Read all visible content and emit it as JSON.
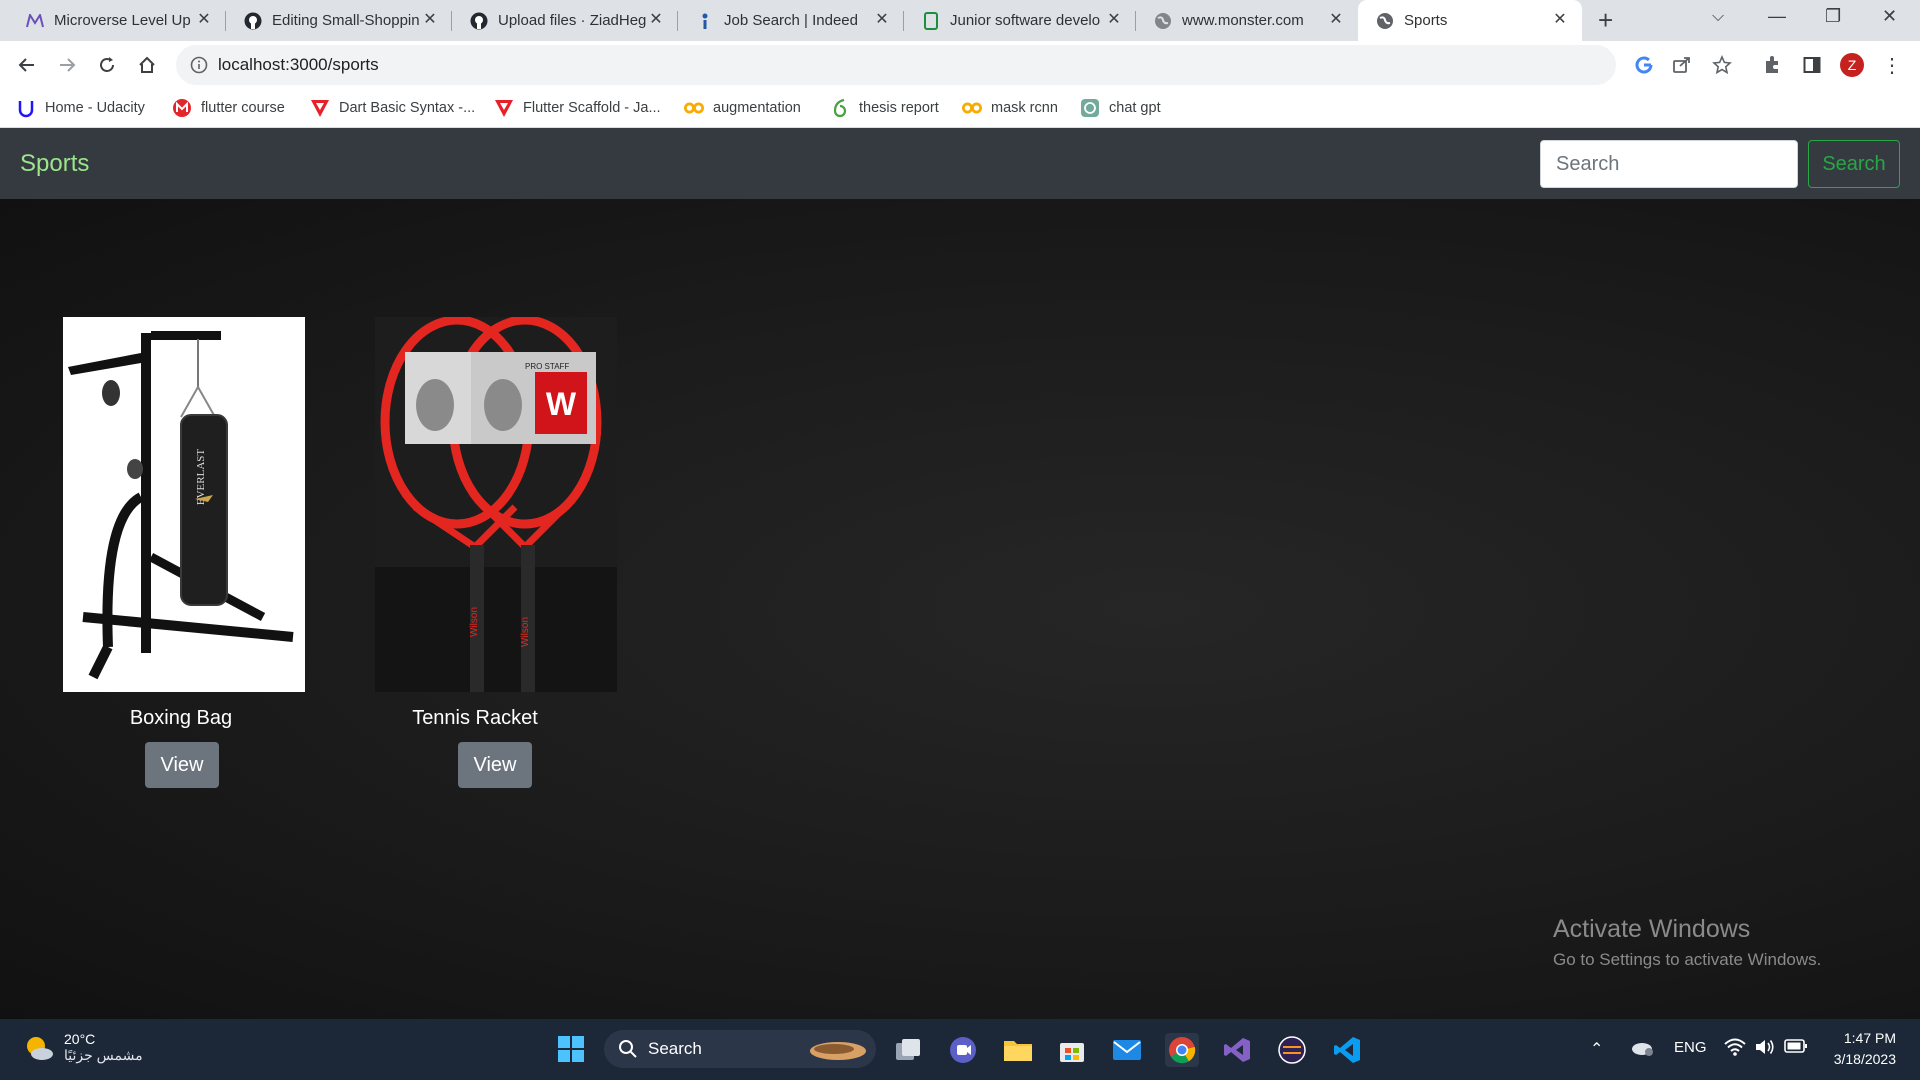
{
  "browser": {
    "tabs": [
      {
        "title": "Microverse Level Up",
        "icon": "microverse-icon",
        "active": false
      },
      {
        "title": "Editing Small-Shoppin",
        "icon": "github-icon",
        "active": false
      },
      {
        "title": "Upload files · ZiadHeg",
        "icon": "github-icon",
        "active": false
      },
      {
        "title": "Job Search | Indeed",
        "icon": "indeed-icon",
        "active": false
      },
      {
        "title": "Junior software develo",
        "icon": "document-icon",
        "active": false
      },
      {
        "title": "www.monster.com",
        "icon": "globe-icon",
        "active": false
      },
      {
        "title": "Sports",
        "icon": "globe-icon",
        "active": true
      }
    ],
    "url": "localhost:3000/sports",
    "profile_initial": "Z",
    "bookmarks": [
      {
        "label": "Home - Udacity",
        "icon": "udacity-icon"
      },
      {
        "label": "flutter course",
        "icon": "m-icon"
      },
      {
        "label": "Dart Basic Syntax -...",
        "icon": "v-icon"
      },
      {
        "label": "Flutter Scaffold - Ja...",
        "icon": "v-icon"
      },
      {
        "label": "augmentation",
        "icon": "colab-icon"
      },
      {
        "label": "thesis report",
        "icon": "overleaf-icon"
      },
      {
        "label": "mask rcnn",
        "icon": "colab-icon"
      },
      {
        "label": "chat gpt",
        "icon": "openai-icon"
      }
    ]
  },
  "page": {
    "brand": "Sports",
    "search": {
      "placeholder": "Search",
      "button": "Search"
    },
    "products": [
      {
        "name": "Boxing Bag",
        "button": "View"
      },
      {
        "name": "Tennis Racket",
        "button": "View"
      }
    ]
  },
  "watermark": {
    "title": "Activate Windows",
    "subtitle": "Go to Settings to activate Windows."
  },
  "taskbar": {
    "temperature": "20°C",
    "weather_desc": "مشمس جزئيًا",
    "search_label": "Search",
    "language": "ENG",
    "time": "1:47 PM",
    "date": "3/18/2023"
  }
}
